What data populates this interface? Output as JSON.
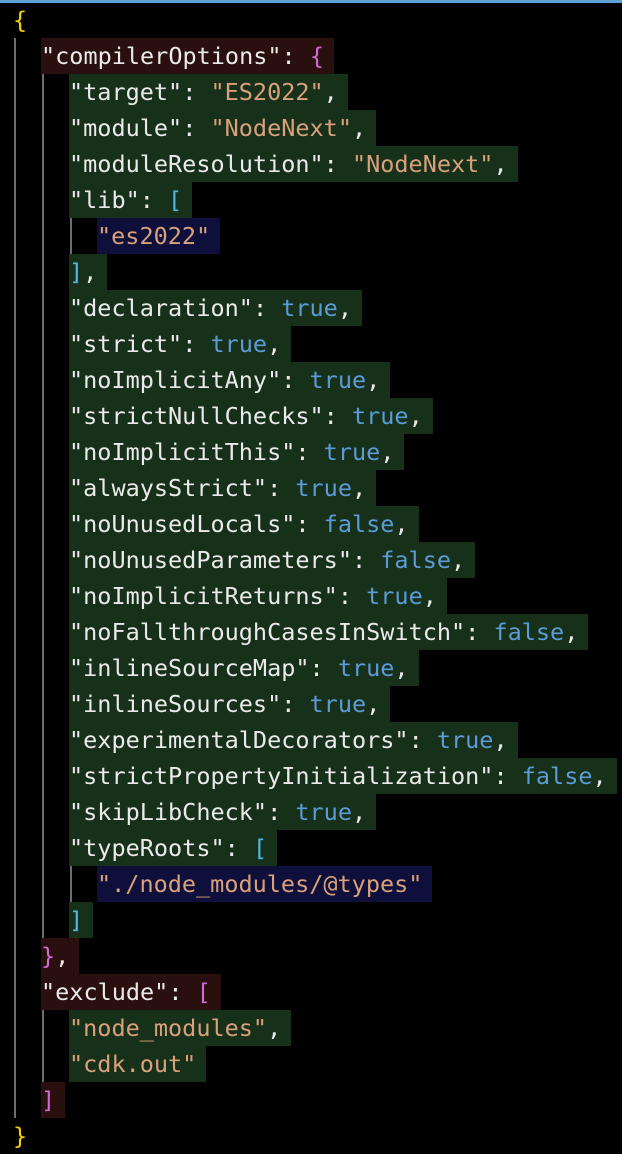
{
  "editor": {
    "language": "json",
    "colors": {
      "background": "#000000",
      "accent_border": "#5aa2d6",
      "key": "#eaeaea",
      "string": "#d9a07c",
      "boolean": "#5c9bd6",
      "brace_level1": "#f5d000",
      "brace_level2": "#d06ad6",
      "bracket_level3": "#4fb8e8",
      "highlight_red": "#2a0f0f",
      "highlight_green": "#17301a",
      "highlight_navy": "#0e0f3a",
      "indent_guide": "#6e6e6e"
    },
    "lines": [
      {
        "indent": 0,
        "bg": "none",
        "tokens": [
          [
            "{",
            "yellow"
          ]
        ]
      },
      {
        "indent": 1,
        "bg": "red",
        "tokens": [
          [
            "\"compilerOptions\"",
            "key"
          ],
          [
            ": ",
            "punct"
          ],
          [
            "{",
            "magenta"
          ]
        ]
      },
      {
        "indent": 2,
        "bg": "green",
        "tokens": [
          [
            "\"target\"",
            "key"
          ],
          [
            ": ",
            "punct"
          ],
          [
            "\"ES2022\"",
            "string"
          ],
          [
            ",",
            "punct"
          ]
        ]
      },
      {
        "indent": 2,
        "bg": "green",
        "tokens": [
          [
            "\"module\"",
            "key"
          ],
          [
            ": ",
            "punct"
          ],
          [
            "\"NodeNext\"",
            "string"
          ],
          [
            ",",
            "punct"
          ]
        ]
      },
      {
        "indent": 2,
        "bg": "green",
        "tokens": [
          [
            "\"moduleResolution\"",
            "key"
          ],
          [
            ": ",
            "punct"
          ],
          [
            "\"NodeNext\"",
            "string"
          ],
          [
            ",",
            "punct"
          ]
        ]
      },
      {
        "indent": 2,
        "bg": "green",
        "tokens": [
          [
            "\"lib\"",
            "key"
          ],
          [
            ": ",
            "punct"
          ],
          [
            "[",
            "cyan"
          ]
        ]
      },
      {
        "indent": 3,
        "bg": "navy",
        "tokens": [
          [
            "\"es2022\"",
            "string"
          ]
        ]
      },
      {
        "indent": 2,
        "bg": "green",
        "tokens": [
          [
            "]",
            "cyan"
          ],
          [
            ",",
            "punct"
          ]
        ]
      },
      {
        "indent": 2,
        "bg": "green",
        "tokens": [
          [
            "\"declaration\"",
            "key"
          ],
          [
            ": ",
            "punct"
          ],
          [
            "true",
            "bool"
          ],
          [
            ",",
            "punct"
          ]
        ]
      },
      {
        "indent": 2,
        "bg": "green",
        "tokens": [
          [
            "\"strict\"",
            "key"
          ],
          [
            ": ",
            "punct"
          ],
          [
            "true",
            "bool"
          ],
          [
            ",",
            "punct"
          ]
        ]
      },
      {
        "indent": 2,
        "bg": "green",
        "tokens": [
          [
            "\"noImplicitAny\"",
            "key"
          ],
          [
            ": ",
            "punct"
          ],
          [
            "true",
            "bool"
          ],
          [
            ",",
            "punct"
          ]
        ]
      },
      {
        "indent": 2,
        "bg": "green",
        "tokens": [
          [
            "\"strictNullChecks\"",
            "key"
          ],
          [
            ": ",
            "punct"
          ],
          [
            "true",
            "bool"
          ],
          [
            ",",
            "punct"
          ]
        ]
      },
      {
        "indent": 2,
        "bg": "green",
        "tokens": [
          [
            "\"noImplicitThis\"",
            "key"
          ],
          [
            ": ",
            "punct"
          ],
          [
            "true",
            "bool"
          ],
          [
            ",",
            "punct"
          ]
        ]
      },
      {
        "indent": 2,
        "bg": "green",
        "tokens": [
          [
            "\"alwaysStrict\"",
            "key"
          ],
          [
            ": ",
            "punct"
          ],
          [
            "true",
            "bool"
          ],
          [
            ",",
            "punct"
          ]
        ]
      },
      {
        "indent": 2,
        "bg": "green",
        "tokens": [
          [
            "\"noUnusedLocals\"",
            "key"
          ],
          [
            ": ",
            "punct"
          ],
          [
            "false",
            "bool"
          ],
          [
            ",",
            "punct"
          ]
        ]
      },
      {
        "indent": 2,
        "bg": "green",
        "tokens": [
          [
            "\"noUnusedParameters\"",
            "key"
          ],
          [
            ": ",
            "punct"
          ],
          [
            "false",
            "bool"
          ],
          [
            ",",
            "punct"
          ]
        ]
      },
      {
        "indent": 2,
        "bg": "green",
        "tokens": [
          [
            "\"noImplicitReturns\"",
            "key"
          ],
          [
            ": ",
            "punct"
          ],
          [
            "true",
            "bool"
          ],
          [
            ",",
            "punct"
          ]
        ]
      },
      {
        "indent": 2,
        "bg": "green",
        "tokens": [
          [
            "\"noFallthroughCasesInSwitch\"",
            "key"
          ],
          [
            ": ",
            "punct"
          ],
          [
            "false",
            "bool"
          ],
          [
            ",",
            "punct"
          ]
        ]
      },
      {
        "indent": 2,
        "bg": "green",
        "tokens": [
          [
            "\"inlineSourceMap\"",
            "key"
          ],
          [
            ": ",
            "punct"
          ],
          [
            "true",
            "bool"
          ],
          [
            ",",
            "punct"
          ]
        ]
      },
      {
        "indent": 2,
        "bg": "green",
        "tokens": [
          [
            "\"inlineSources\"",
            "key"
          ],
          [
            ": ",
            "punct"
          ],
          [
            "true",
            "bool"
          ],
          [
            ",",
            "punct"
          ]
        ]
      },
      {
        "indent": 2,
        "bg": "green",
        "tokens": [
          [
            "\"experimentalDecorators\"",
            "key"
          ],
          [
            ": ",
            "punct"
          ],
          [
            "true",
            "bool"
          ],
          [
            ",",
            "punct"
          ]
        ]
      },
      {
        "indent": 2,
        "bg": "green",
        "tokens": [
          [
            "\"strictPropertyInitialization\"",
            "key"
          ],
          [
            ": ",
            "punct"
          ],
          [
            "false",
            "bool"
          ],
          [
            ",",
            "punct"
          ]
        ]
      },
      {
        "indent": 2,
        "bg": "green",
        "tokens": [
          [
            "\"skipLibCheck\"",
            "key"
          ],
          [
            ": ",
            "punct"
          ],
          [
            "true",
            "bool"
          ],
          [
            ",",
            "punct"
          ]
        ]
      },
      {
        "indent": 2,
        "bg": "green",
        "tokens": [
          [
            "\"typeRoots\"",
            "key"
          ],
          [
            ": ",
            "punct"
          ],
          [
            "[",
            "cyan"
          ]
        ]
      },
      {
        "indent": 3,
        "bg": "navy",
        "tokens": [
          [
            "\"./node_modules/@types\"",
            "string"
          ]
        ]
      },
      {
        "indent": 2,
        "bg": "green",
        "tokens": [
          [
            "]",
            "cyan"
          ]
        ]
      },
      {
        "indent": 1,
        "bg": "red",
        "tokens": [
          [
            "}",
            "magenta"
          ],
          [
            ",",
            "punct"
          ]
        ]
      },
      {
        "indent": 1,
        "bg": "red",
        "tokens": [
          [
            "\"exclude\"",
            "key"
          ],
          [
            ": ",
            "punct"
          ],
          [
            "[",
            "magenta"
          ]
        ]
      },
      {
        "indent": 2,
        "bg": "green",
        "tokens": [
          [
            "\"node_modules\"",
            "string"
          ],
          [
            ",",
            "punct"
          ]
        ]
      },
      {
        "indent": 2,
        "bg": "green",
        "tokens": [
          [
            "\"cdk.out\"",
            "string"
          ]
        ]
      },
      {
        "indent": 1,
        "bg": "red",
        "tokens": [
          [
            "]",
            "magenta"
          ]
        ]
      },
      {
        "indent": 0,
        "bg": "none",
        "tokens": [
          [
            "}",
            "yellow"
          ]
        ]
      }
    ]
  }
}
